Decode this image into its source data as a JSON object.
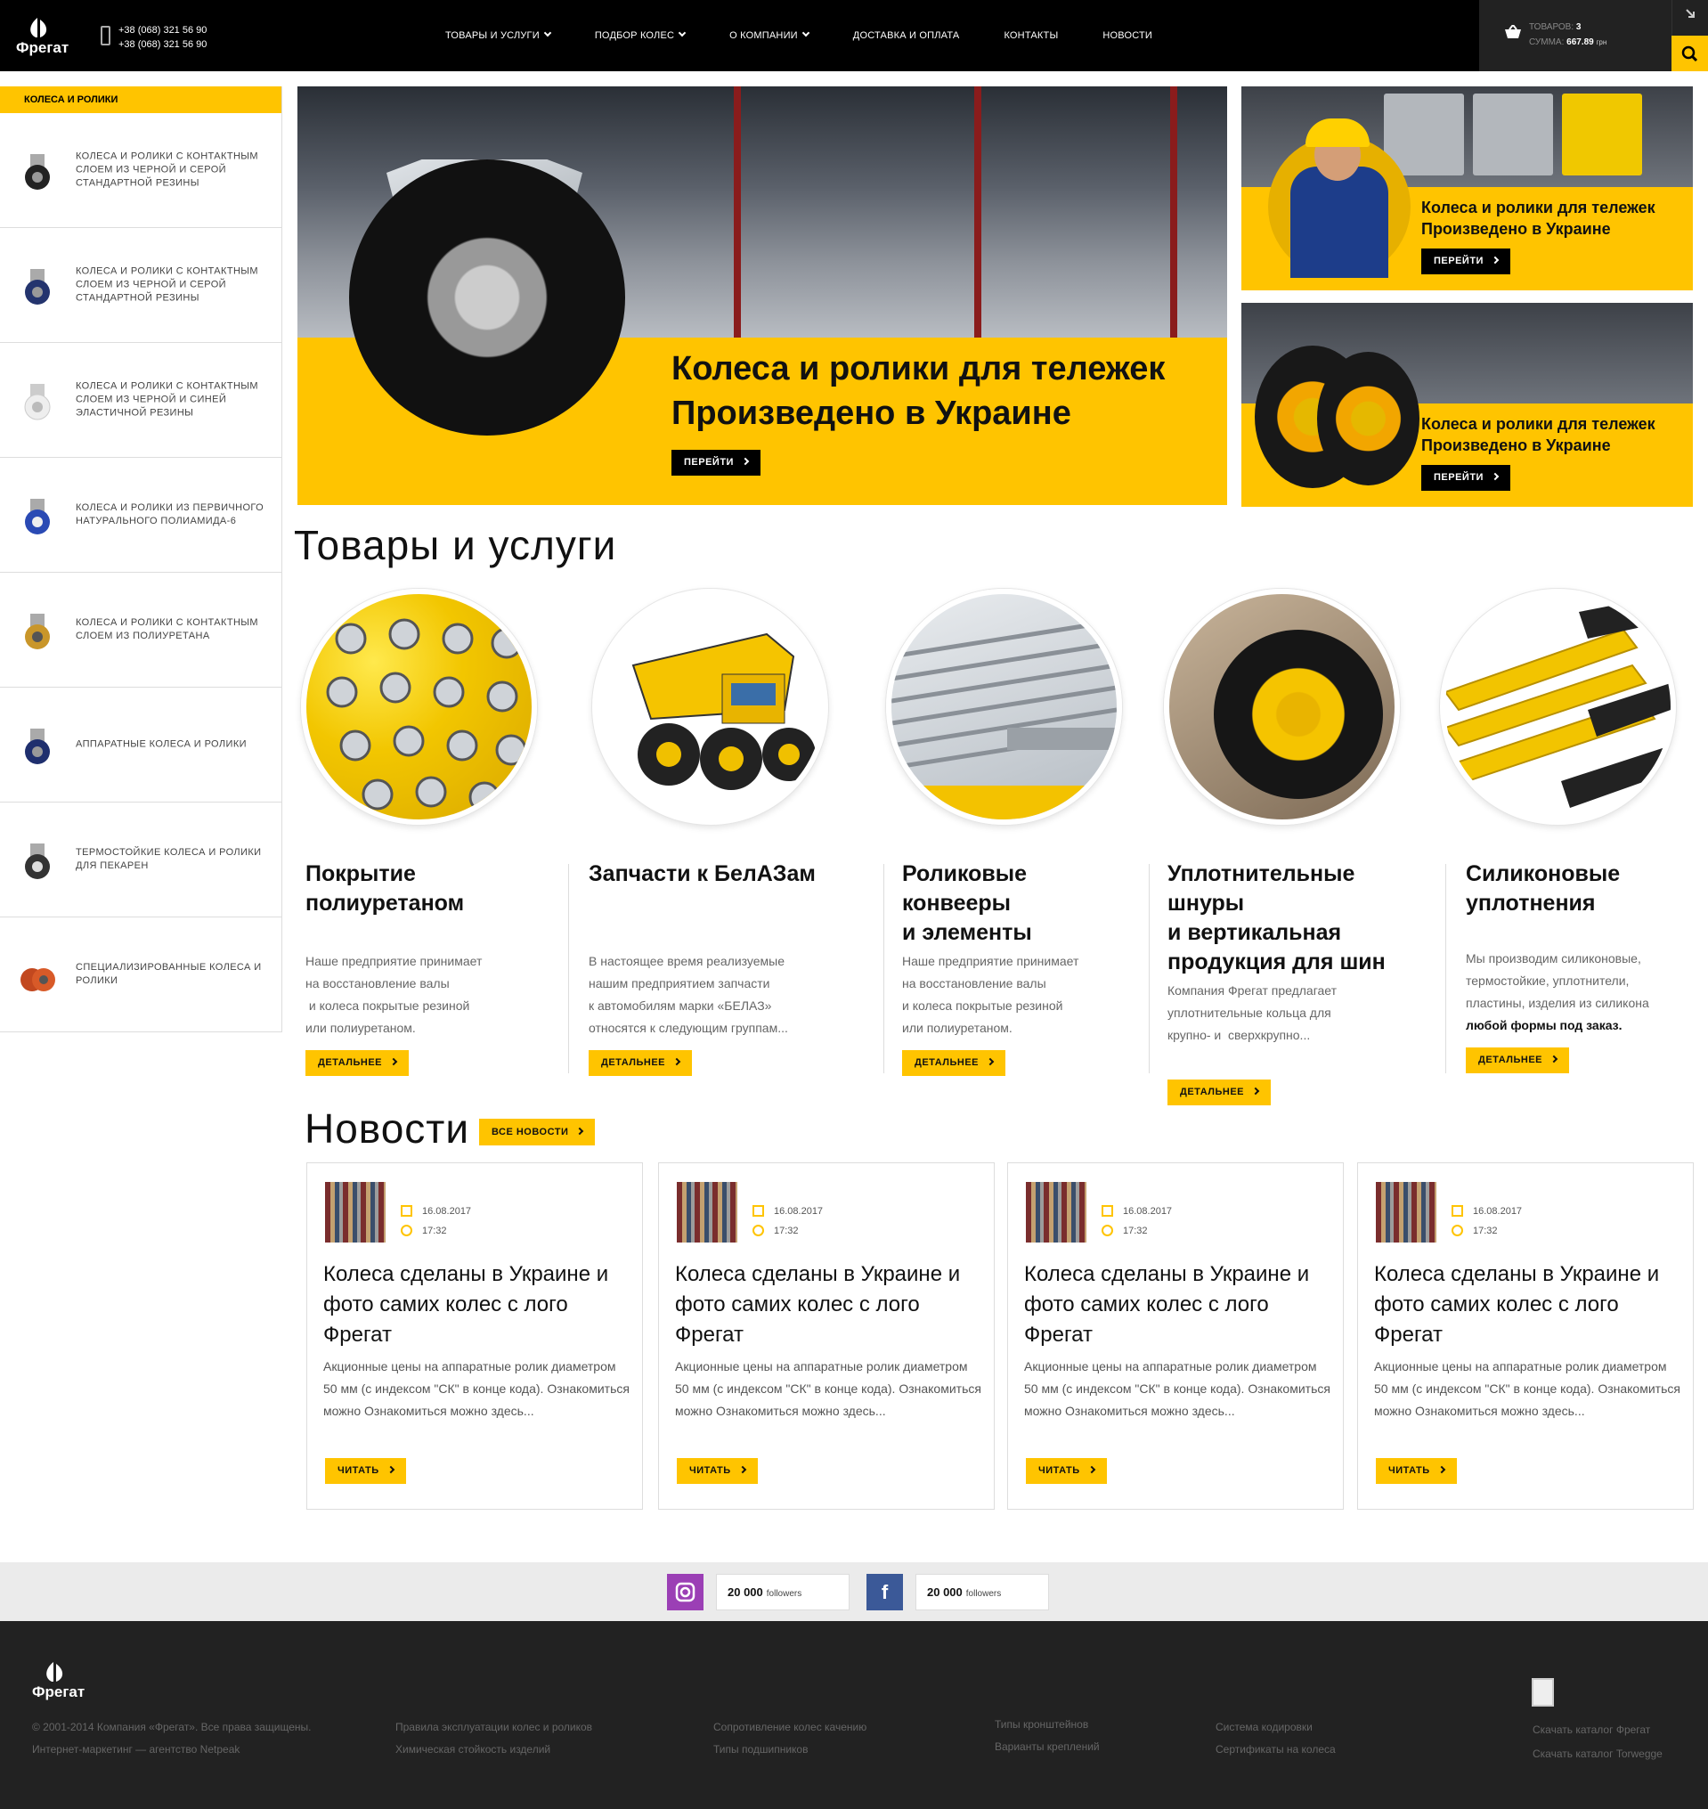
{
  "header": {
    "logo_text": "Фрегат",
    "phones": [
      "+38 (068) 321 56 90",
      "+38 (068) 321 56 90"
    ],
    "nav": [
      {
        "label": "Товары и услуги",
        "dropdown": true
      },
      {
        "label": "Подбор колес",
        "dropdown": true
      },
      {
        "label": "О компании",
        "dropdown": true
      },
      {
        "label": "Доставка и оплата",
        "dropdown": false
      },
      {
        "label": "Контакты",
        "dropdown": false
      },
      {
        "label": "Новости",
        "dropdown": false
      }
    ],
    "cart": {
      "items_label": "Товаров:",
      "items_value": "3",
      "sum_label": "Сумма:",
      "sum_value": "667.89",
      "currency": "грн"
    }
  },
  "sidebar": {
    "title": "Колеса и ролики",
    "items": [
      {
        "label": "Колеса и ролики с контактным слоем из черной и серой стандартной резины"
      },
      {
        "label": "Колеса и ролики с контактным слоем из черной и серой стандартной резины"
      },
      {
        "label": "Колеса и ролики с контактным слоем из черной и синей эластичной резины"
      },
      {
        "label": "Колеса и ролики из первичного натурального полиамида-6"
      },
      {
        "label": "Колеса и ролики с контактным слоем из полиуретана"
      },
      {
        "label": "Аппаратные колеса и ролики"
      },
      {
        "label": "Термостойкие колеса и ролики для пекарен"
      },
      {
        "label": "Специализированные колеса и ролики"
      }
    ]
  },
  "hero": {
    "title_line1": "Колеса и ролики для тележек",
    "title_line2": "Произведено в Украине",
    "button": "Перейти"
  },
  "promos": [
    {
      "title_line1": "Колеса и ролики для тележек",
      "title_line2": "Произведено в Украине",
      "button": "Перейти"
    },
    {
      "title_line1": "Колеса и ролики для тележек",
      "title_line2": "Произведено в Украине",
      "button": "Перейти"
    }
  ],
  "products": {
    "section_title": "Товары и услуги",
    "items": [
      {
        "title_lines": [
          "Покрытие",
          "полиуретаном"
        ],
        "text_lines": [
          "Наше предприятие принимает",
          "на восстановление валы",
          " и колеса покрытые резиной",
          "или полиуретаном."
        ],
        "button": "Детальнее"
      },
      {
        "title_lines": [
          "Запчасти к БелАЗам"
        ],
        "text_lines": [
          "В настоящее время реализуемые",
          "нашим предприятием запчасти",
          "к автомобилям марки «БЕЛАЗ»",
          "относятся к следующим группам..."
        ],
        "button": "Детальнее"
      },
      {
        "title_lines": [
          "Роликовые",
          "конвееры",
          "и элементы"
        ],
        "text_lines": [
          "Наше предприятие принимает",
          "на восстановление валы",
          "и колеса покрытые резиной",
          "или полиуретаном."
        ],
        "button": "Детальнее"
      },
      {
        "title_lines": [
          "Уплотнительные шнуры",
          "и вертикальная",
          "продукция для шин"
        ],
        "text_lines": [
          "Компания Фрегат предлагает",
          "уплотнительные кольца для",
          "крупно- и  сверхкрупно..."
        ],
        "button": "Детальнее"
      },
      {
        "title_lines": [
          "Силиконовые",
          "уплотнения"
        ],
        "text_lines": [
          "Мы производим силиконовые,",
          "термостойкие, уплотнители,",
          "пластины, изделия из силикона"
        ],
        "text_bold": "любой формы под заказ.",
        "button": "Детальнее"
      }
    ]
  },
  "news": {
    "section_title": "Новости",
    "all_button": "Все новости",
    "items": [
      {
        "date": "16.08.2017",
        "time": "17:32",
        "title": "Колеса сделаны в Украине и фото самих колес с лого Фрегат",
        "text": "Акционные цены на аппаратные ролик диаметром 50 мм (с индексом \"СК\" в конце кода). Ознакомиться можно Ознакомиться можно  здесь...",
        "button": "Читать"
      },
      {
        "date": "16.08.2017",
        "time": "17:32",
        "title": "Колеса сделаны в Украине и фото самих колес с лого Фрегат",
        "text": "Акционные цены на аппаратные ролик диаметром 50 мм (с индексом \"СК\" в конце кода). Ознакомиться можно Ознакомиться можно  здесь...",
        "button": "Читать"
      },
      {
        "date": "16.08.2017",
        "time": "17:32",
        "title": "Колеса сделаны в Украине и фото самих колес с лого Фрегат",
        "text": "Акционные цены на аппаратные ролик диаметром 50 мм (с индексом \"СК\" в конце кода). Ознакомиться можно Ознакомиться можно  здесь...",
        "button": "Читать"
      },
      {
        "date": "16.08.2017",
        "time": "17:32",
        "title": "Колеса сделаны в Украине и фото самих колес с лого Фрегат",
        "text": "Акционные цены на аппаратные ролик диаметром 50 мм (с индексом \"СК\" в конце кода). Ознакомиться можно Ознакомиться можно  здесь...",
        "button": "Читать"
      }
    ]
  },
  "social": {
    "instagram": {
      "count": "20 000",
      "unit": "followers",
      "color": "#9b3fb5"
    },
    "facebook": {
      "count": "20 000",
      "unit": "followers",
      "color": "#3b5998"
    }
  },
  "footer": {
    "logo_text": "Фрегат",
    "copyright": "© 2001-2014 Компания «Фрегат». Все права защищены.",
    "agency": "Интернет-маркетинг — агентство Netpeak",
    "columns": [
      [
        "Правила эксплуатации колес и роликов",
        "Химическая стойкость изделий"
      ],
      [
        "Сопротивление колес качению",
        "Типы подшипников"
      ],
      [
        "Типы кронштейнов",
        "Варианты креплений"
      ],
      [
        "Система кодировки",
        "Сертификаты на колеса"
      ]
    ],
    "downloads": [
      "Скачать каталог Фрегат",
      "Скачать каталог Torwegge"
    ]
  },
  "colors": {
    "accent": "#ffc400",
    "dark": "#000000",
    "footer": "#222222"
  }
}
